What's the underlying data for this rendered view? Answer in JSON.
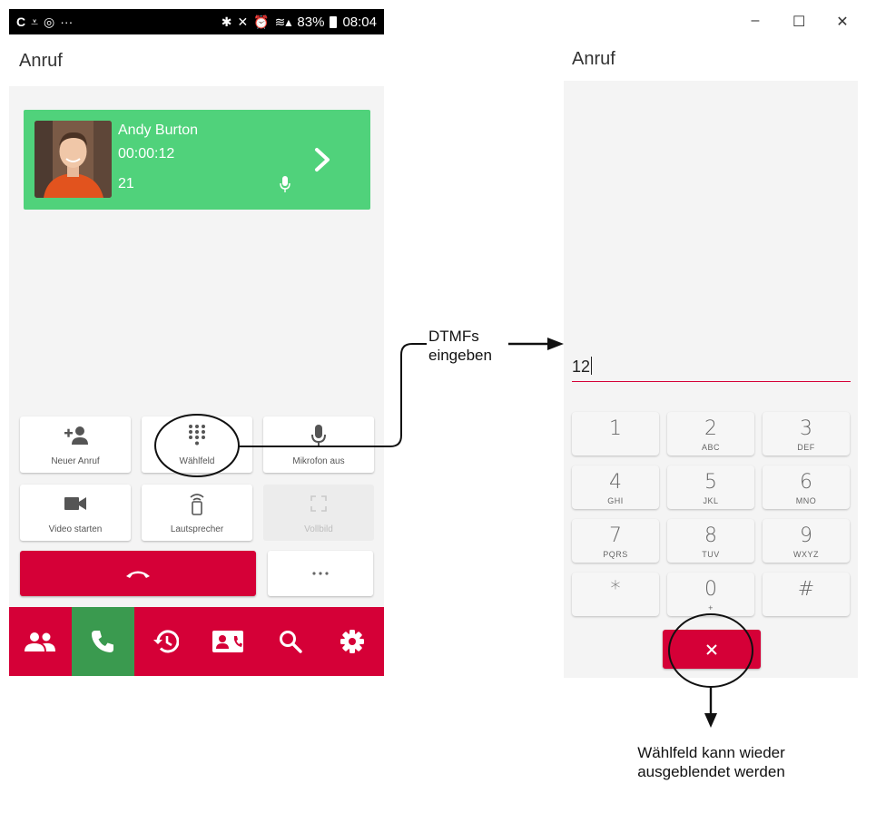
{
  "mobile": {
    "status_bar": {
      "battery": "83%",
      "time": "08:04"
    },
    "title": "Anruf",
    "contact": {
      "name": "Andy Burton",
      "duration": "00:00:12",
      "extension": "21"
    },
    "buttons": {
      "new_call": "Neuer Anruf",
      "dialpad": "Wählfeld",
      "mute": "Mikrofon aus",
      "video": "Video starten",
      "speaker": "Lautsprecher",
      "fullscreen": "Vollbild"
    },
    "nav": [
      "contacts-icon",
      "phone-icon",
      "history-icon",
      "contact-card-icon",
      "search-icon",
      "settings-icon"
    ],
    "colors": {
      "accent": "#d50037",
      "call_green": "#50d27b",
      "nav_active": "#3a9a4f"
    }
  },
  "annotations": {
    "dtmf_line1": "DTMFs",
    "dtmf_line2": "eingeben",
    "hide_line1": "Wählfeld kann wieder",
    "hide_line2": "ausgeblendet werden"
  },
  "desktop": {
    "title": "Anruf",
    "window_controls": {
      "minimize": "–",
      "maximize": "☐",
      "close": "✕"
    },
    "input_value": "12",
    "keys": [
      {
        "digit": "1",
        "letters": ""
      },
      {
        "digit": "2",
        "letters": "ABC"
      },
      {
        "digit": "3",
        "letters": "DEF"
      },
      {
        "digit": "4",
        "letters": "GHI"
      },
      {
        "digit": "5",
        "letters": "JKL"
      },
      {
        "digit": "6",
        "letters": "MNO"
      },
      {
        "digit": "7",
        "letters": "PQRS"
      },
      {
        "digit": "8",
        "letters": "TUV"
      },
      {
        "digit": "9",
        "letters": "WXYZ"
      },
      {
        "digit": "*",
        "letters": ""
      },
      {
        "digit": "0",
        "letters": "+"
      },
      {
        "digit": "#",
        "letters": ""
      }
    ]
  }
}
